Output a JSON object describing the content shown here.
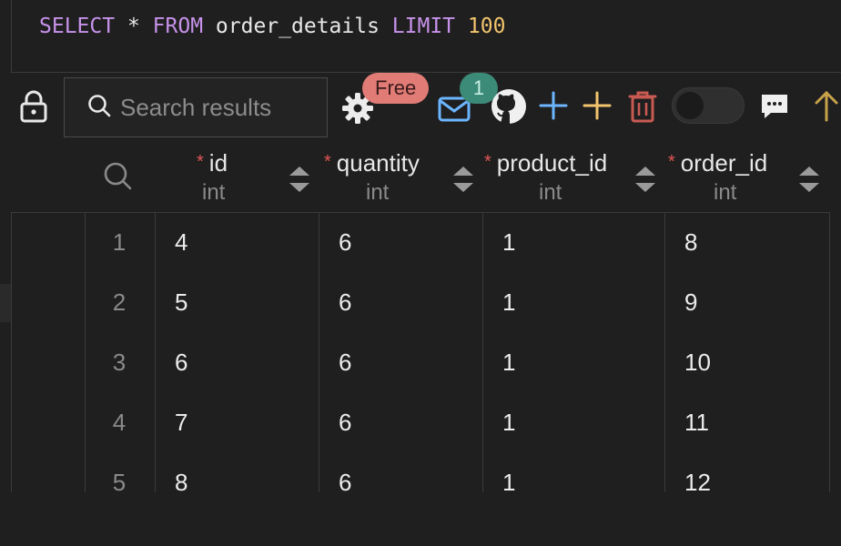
{
  "editor": {
    "sql_select": "SELECT",
    "sql_star": "*",
    "sql_from": "FROM",
    "sql_table": "order_details",
    "sql_limit": "LIMIT",
    "sql_limit_value": "100"
  },
  "toolbar": {
    "search_placeholder": "Search results",
    "free_badge": "Free",
    "notification_count": "1",
    "toggle_on": false
  },
  "icons": {
    "lock": "lock-icon",
    "search": "search-icon",
    "gear": "gear-icon",
    "mail": "mail-icon",
    "github": "github-icon",
    "add_row": "plus-icon",
    "add_column": "plus-icon",
    "delete": "trash-icon",
    "comment": "chat-icon",
    "upload": "arrow-up-icon"
  },
  "colors": {
    "keyword": "#c792ea",
    "number": "#f2c46d",
    "free_badge": "#e07b76",
    "count_badge": "#3c8a78",
    "required": "#e25555",
    "plus_blue": "#6cb6ff",
    "plus_yellow": "#f2c46d",
    "trash": "#c85a52"
  },
  "grid": {
    "columns": [
      {
        "name": "id",
        "type": "int",
        "required": "*"
      },
      {
        "name": "quantity",
        "type": "int",
        "required": "*"
      },
      {
        "name": "product_id",
        "type": "int",
        "required": "*"
      },
      {
        "name": "order_id",
        "type": "int",
        "required": "*"
      }
    ],
    "rows": [
      {
        "n": "1",
        "cells": [
          "4",
          "6",
          "1",
          "8"
        ]
      },
      {
        "n": "2",
        "cells": [
          "5",
          "6",
          "1",
          "9"
        ]
      },
      {
        "n": "3",
        "cells": [
          "6",
          "6",
          "1",
          "10"
        ]
      },
      {
        "n": "4",
        "cells": [
          "7",
          "6",
          "1",
          "11"
        ]
      },
      {
        "n": "5",
        "cells": [
          "8",
          "6",
          "1",
          "12"
        ]
      }
    ]
  }
}
